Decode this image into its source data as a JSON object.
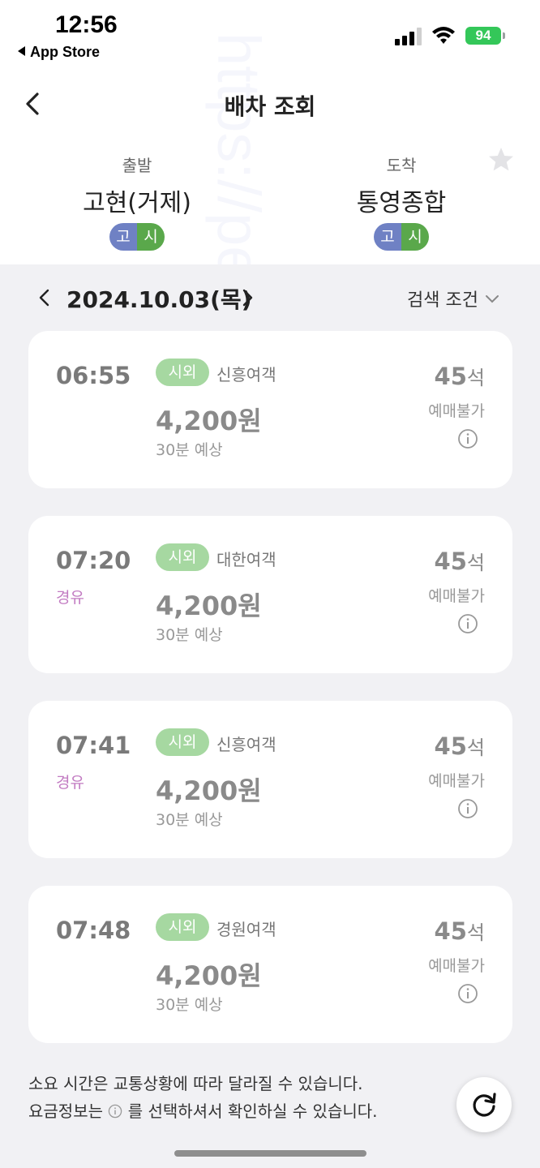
{
  "status_bar": {
    "time": "12:56",
    "back_app": "App Store",
    "battery": "94"
  },
  "header": {
    "title": "배차 조회"
  },
  "route": {
    "departure_label": "출발",
    "departure": "고현(거제)",
    "departure_badges": [
      "고",
      "시"
    ],
    "arrival_label": "도착",
    "arrival": "통영종합",
    "arrival_badges": [
      "고",
      "시"
    ]
  },
  "date_bar": {
    "date": "2024.10.03(목)",
    "filter_label": "검색 조건"
  },
  "results": [
    {
      "time": "06:55",
      "via": "",
      "type": "시외",
      "company": "신흥여객",
      "fare": "4,200원",
      "duration": "30분 예상",
      "seats": "45",
      "seats_unit": "석",
      "status": "예매불가"
    },
    {
      "time": "07:20",
      "via": "경유",
      "type": "시외",
      "company": "대한여객",
      "fare": "4,200원",
      "duration": "30분 예상",
      "seats": "45",
      "seats_unit": "석",
      "status": "예매불가"
    },
    {
      "time": "07:41",
      "via": "경유",
      "type": "시외",
      "company": "신흥여객",
      "fare": "4,200원",
      "duration": "30분 예상",
      "seats": "45",
      "seats_unit": "석",
      "status": "예매불가"
    },
    {
      "time": "07:48",
      "via": "",
      "type": "시외",
      "company": "경원여객",
      "fare": "4,200원",
      "duration": "30분 예상",
      "seats": "45",
      "seats_unit": "석",
      "status": "예매불가"
    }
  ],
  "notes": {
    "line1": "소요 시간은 교통상황에 따라 달라질 수 있습니다.",
    "line2_pre": "요금정보는",
    "line2_post": "를 선택하셔서 확인하실 수 있습니다."
  },
  "watermark": "https://pepes119.tistory.com",
  "colors": {
    "via": "#c27bc2",
    "type_tag": "#a6d8a1",
    "badge_high": "#6f81c4",
    "badge_city": "#5aa84b",
    "battery": "#34c759"
  }
}
